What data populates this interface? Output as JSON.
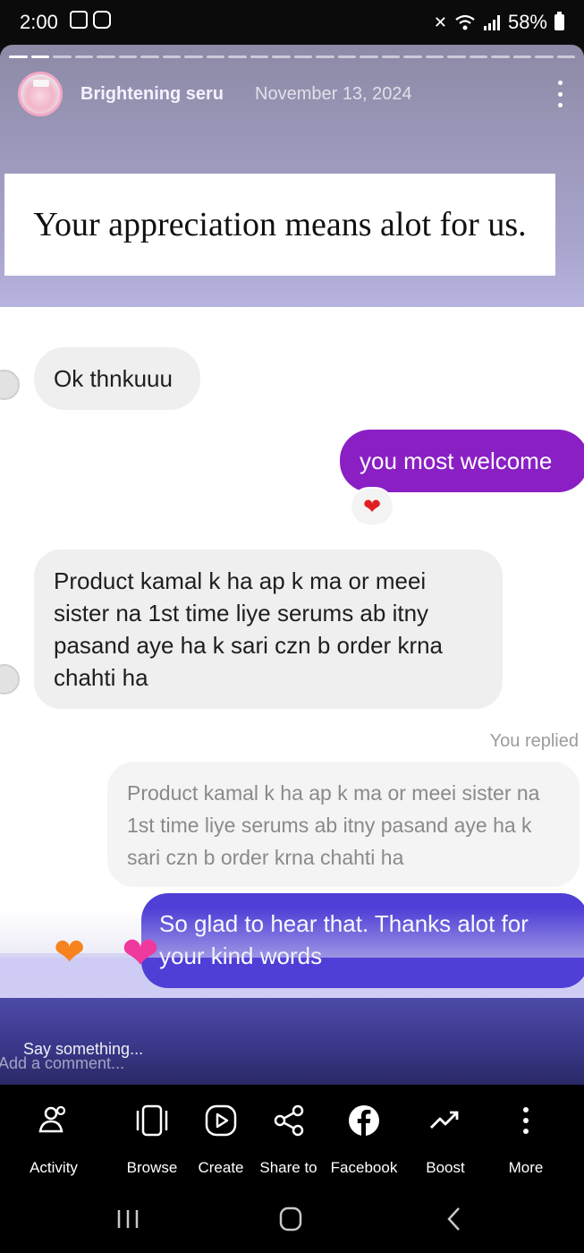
{
  "status_bar": {
    "time": "2:00",
    "battery": "58%"
  },
  "story": {
    "account_name": "Brightening seru",
    "date": "November 13, 2024",
    "caption": "Your appreciation means alot for us."
  },
  "chat": {
    "msg1": "Ok thnkuuu",
    "msg2": "you most welcome",
    "msg3": "Product kamal k ha ap k ma or meei sister na 1st time liye serums ab itny pasand aye ha k sari czn b order krna chahti ha",
    "replied_label": "You replied",
    "quote": "Product kamal k ha ap k ma or meei sister na 1st time liye serums ab itny pasand aye ha k sari czn b order krna chahti ha",
    "msg4": "So glad to hear that. Thanks alot for your kind words",
    "colors": {
      "sent_purple": "#8a1fc4",
      "sent_indigo": "#4f3fd6"
    }
  },
  "comment": {
    "placeholder": "Say something...",
    "placeholder_behind": "Add a comment..."
  },
  "actions": [
    {
      "label": "Activity",
      "icon": "people-icon"
    },
    {
      "label": "Browse",
      "icon": "carousel-icon"
    },
    {
      "label": "Create",
      "icon": "play-icon"
    },
    {
      "label": "Share to",
      "icon": "share-icon"
    },
    {
      "label": "Facebook",
      "icon": "facebook-icon"
    },
    {
      "label": "Boost",
      "icon": "trend-icon"
    },
    {
      "label": "More",
      "icon": "more-vertical-icon"
    }
  ]
}
